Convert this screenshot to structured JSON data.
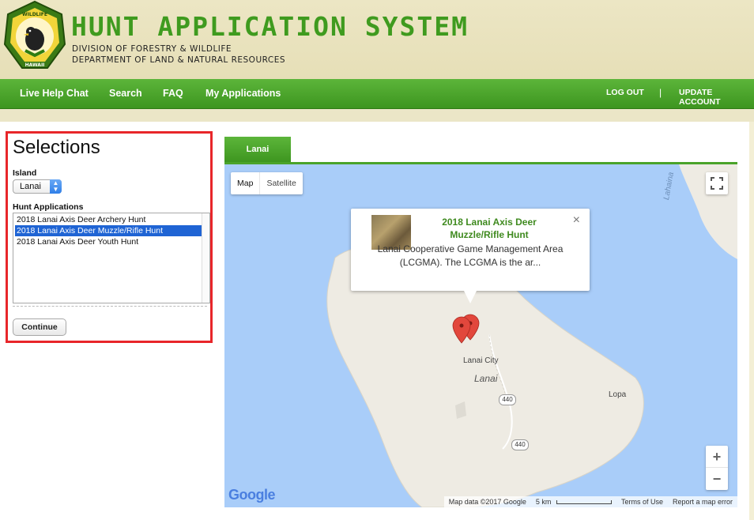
{
  "header": {
    "title": "HUNT APPLICATION SYSTEM",
    "subtitle_1": "DIVISION OF FORESTRY & WILDLIFE",
    "subtitle_2": "DEPARTMENT OF LAND & NATURAL RESOURCES",
    "logo_text": "FORESTRY AND WILDLIFE HAWAII"
  },
  "nav": {
    "items": [
      "Live Help Chat",
      "Search",
      "FAQ",
      "My Applications"
    ],
    "log_out": "LOG OUT",
    "separator": "|",
    "update_account": "UPDATE ACCOUNT"
  },
  "selections": {
    "title": "Selections",
    "island_label": "Island",
    "island_value": "Lanai",
    "hunt_label": "Hunt Applications",
    "hunts": [
      "2018 Lanai Axis Deer Archery Hunt",
      "2018 Lanai Axis Deer Muzzle/Rifle Hunt",
      "2018 Lanai Axis Deer Youth Hunt"
    ],
    "selected_index": 1,
    "continue_label": "Continue"
  },
  "map": {
    "tab_label": "Lanai",
    "map_type_map": "Map",
    "map_type_satellite": "Satellite",
    "info_title": "2018 Lanai Axis Deer Muzzle/Rifle Hunt",
    "info_desc": "Lanai Cooperative Game Management Area (LCGMA).     The LCGMA is the ar...",
    "close_glyph": "×",
    "labels": {
      "lanai_city": "Lanai City",
      "lanai": "Lanai",
      "lopa": "Lopa",
      "lahaina": "Lahaina",
      "road_1": "440",
      "road_2": "440"
    },
    "zoom_in": "+",
    "zoom_out": "−",
    "google": "Google",
    "attribution": {
      "map_data": "Map data ©2017 Google",
      "scale": "5 km",
      "terms": "Terms of Use",
      "report": "Report a map error"
    }
  },
  "colors": {
    "brand_green": "#3f9b1f",
    "selection_border": "#e8262a",
    "selected_row": "#1f64d4",
    "water": "#a9cdf9",
    "land": "#eeebe3"
  }
}
